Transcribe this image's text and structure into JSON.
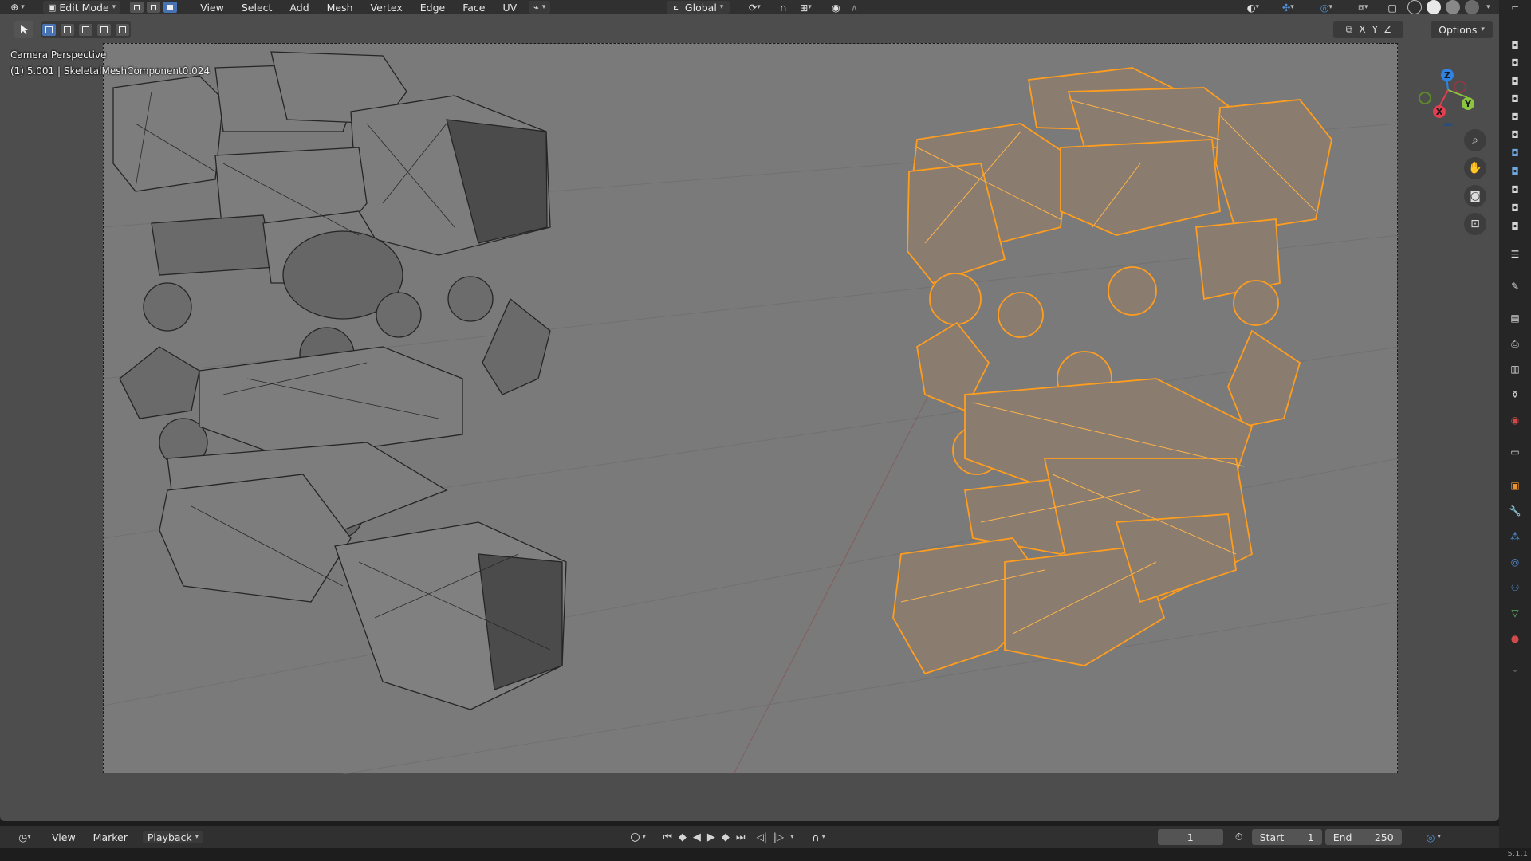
{
  "header": {
    "mode_label": "Edit Mode",
    "menus": [
      "View",
      "Select",
      "Add",
      "Mesh",
      "Vertex",
      "Edge",
      "Face",
      "UV"
    ],
    "transform_orientation": "Global",
    "options_label": "Options",
    "axis_x": "X",
    "axis_y": "Y",
    "axis_z": "Z"
  },
  "viewport": {
    "view_name": "Camera Perspective",
    "object_info": "(1) 5.001 | SkeletalMeshComponent0.024",
    "wire_color": "#2b2b2b",
    "selected_color": "#ff9d1e",
    "camera_bg": "#7a7a7a"
  },
  "gizmo": {
    "x": "X",
    "y": "Y",
    "z": "Z",
    "x_color": "#e53e50",
    "y_color": "#8bc53f",
    "z_color": "#2f83e5"
  },
  "timeline": {
    "view": "View",
    "marker": "Marker",
    "playback": "Playback",
    "current_frame": "1",
    "start_label": "Start",
    "start_value": "1",
    "end_label": "End",
    "end_value": "250"
  },
  "status": {
    "version": "5.1.1"
  }
}
